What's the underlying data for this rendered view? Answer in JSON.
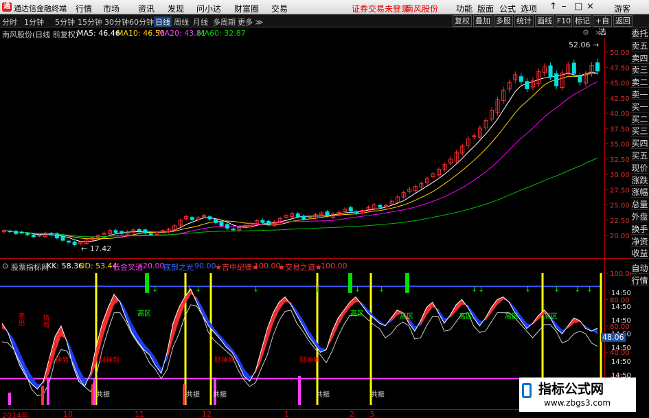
{
  "window": {
    "app_title": "通达信金融终端",
    "logo": "通",
    "menus": [
      "行情",
      "市场",
      "资讯",
      "发现",
      "问小达",
      "财富圈",
      "交易"
    ],
    "status": "证券交易未登录",
    "stock": "南风股份",
    "right_menus": [
      "功能",
      "版面",
      "公式",
      "选项"
    ],
    "user": "游客"
  },
  "periods": [
    "分时",
    "1分钟",
    "5分钟",
    "15分钟",
    "30分钟",
    "60分钟",
    "日线",
    "周线",
    "月线",
    "多周期",
    "更多"
  ],
  "period_selected": "日线",
  "toolbar_right": [
    "复权",
    "叠加",
    "多股",
    "统计",
    "画线",
    "F10",
    "标记",
    "+自选",
    "返回"
  ],
  "price_header": {
    "title": "南风股份(日线 前复权)",
    "ma5": "MA5: 46.46",
    "ma10": "MA10: 46.50",
    "ma20": "MA20: 43.81",
    "ma60": "MA60: 32.87"
  },
  "price_axis": [
    "50.00",
    "47.50",
    "45.00",
    "42.50",
    "40.00",
    "37.50",
    "35.00",
    "32.50",
    "30.00",
    "27.50",
    "25.00",
    "22.50",
    "20.00"
  ],
  "price_annotations": {
    "high": "52.06",
    "low": "17.42"
  },
  "side_tabs": [
    "委托",
    "卖五",
    "卖四",
    "卖三",
    "卖二",
    "卖一",
    "买一",
    "买二",
    "买三",
    "买四",
    "买五",
    "现价",
    "涨跌",
    "涨幅",
    "总量",
    "外盘",
    "换手",
    "净资",
    "收益"
  ],
  "side_tabs_lower": [
    "自动",
    "行情"
  ],
  "indicator_header": {
    "name": "股票指标网",
    "kk": "KK: 58.36",
    "dd": "DD: 53.44",
    "t1": "低金叉通",
    "v1": "20.00",
    "t2": "底部之光",
    "v2": "90.00",
    "t3": "★吉中纪律★",
    "v3": "100.00",
    "t4": "★交易之道★",
    "v4": "100.00"
  },
  "indicator_axis": [
    "100.00",
    "80.00",
    "60.00",
    "40.00",
    "20.00",
    "14:50",
    "14:50",
    "14:50",
    "14:50",
    "14:50",
    "14:50",
    "14:50",
    "14:50"
  ],
  "indicator_value": "48.06",
  "indicator_labels": {
    "buy": "卖出",
    "hold": "持有",
    "zone_high": "高区",
    "bottom": "财神到",
    "resonate": "共振"
  },
  "time_axis": [
    "2014年",
    "10",
    "11",
    "12",
    "1",
    "2",
    "3"
  ],
  "watermark": {
    "title": "指标公式网",
    "url": "www.zbgs3.com"
  },
  "colors": {
    "up": "#ff3232",
    "down": "#00e0e0",
    "ma5": "#ffffff",
    "ma10": "#ffd700",
    "ma20": "#ff00ff",
    "ma60": "#00c000",
    "accent": "#e00000"
  },
  "chart_data": [
    {
      "type": "candlestick",
      "title": "南风股份(日线 前复权)",
      "ylim": [
        17.42,
        52.06
      ],
      "series": [
        {
          "name": "MA5",
          "last": 46.46
        },
        {
          "name": "MA10",
          "last": 46.5
        },
        {
          "name": "MA20",
          "last": 43.81
        },
        {
          "name": "MA60",
          "last": 32.87
        }
      ],
      "closes": [
        20.8,
        20.6,
        20.3,
        20.5,
        20.1,
        19.8,
        20.0,
        20.4,
        20.2,
        19.6,
        19.2,
        18.9,
        18.5,
        18.9,
        19.3,
        19.6,
        20.0,
        20.4,
        20.8,
        20.5,
        20.3,
        20.6,
        20.9,
        20.7,
        20.4,
        20.2,
        20.5,
        20.8,
        21.0,
        21.6,
        22.5,
        23.1,
        22.6,
        22.9,
        23.3,
        22.7,
        22.1,
        21.6,
        21.2,
        20.9,
        21.3,
        21.6,
        22.0,
        22.4,
        22.1,
        21.8,
        22.2,
        22.8,
        23.3,
        23.6,
        23.1,
        22.7,
        23.0,
        23.4,
        23.7,
        23.2,
        23.5,
        23.8,
        24.3,
        24.0,
        23.7,
        24.1,
        24.6,
        25.0,
        24.6,
        24.9,
        25.6,
        26.3,
        27.0,
        27.6,
        28.0,
        28.5,
        29.3,
        30.1,
        30.8,
        31.6,
        32.5,
        33.6,
        34.6,
        35.8,
        36.3,
        37.6,
        38.8,
        40.5,
        42.2,
        43.8,
        45.0,
        46.3,
        45.2,
        44.0,
        45.3,
        46.8,
        47.6,
        46.0,
        44.5,
        46.6,
        47.9,
        46.5,
        45.1,
        46.4,
        47.8,
        46.9
      ]
    },
    {
      "type": "line",
      "title": "股票指标网",
      "ylim": [
        0,
        100
      ],
      "series": [
        {
          "name": "KK",
          "last": 58.36
        },
        {
          "name": "DD",
          "last": 53.44
        }
      ],
      "references": [
        {
          "name": "低金叉通",
          "value": 20.0
        },
        {
          "name": "底部之光",
          "value": 90.0
        },
        {
          "name": "★吉中纪律★",
          "value": 100.0
        },
        {
          "name": "★交易之道★",
          "value": 100.0
        }
      ],
      "kk": [
        62,
        55,
        42,
        30,
        22,
        16,
        12,
        18,
        35,
        52,
        60,
        48,
        30,
        18,
        14,
        24,
        45,
        62,
        74,
        84,
        78,
        66,
        55,
        48,
        42,
        38,
        30,
        24,
        40,
        62,
        74,
        82,
        88,
        78,
        68,
        60,
        55,
        50,
        44,
        40,
        32,
        22,
        18,
        26,
        42,
        58,
        70,
        78,
        82,
        76,
        68,
        60,
        52,
        46,
        40,
        42,
        56,
        66,
        72,
        78,
        82,
        76,
        70,
        66,
        62,
        60,
        66,
        72,
        70,
        62,
        56,
        64,
        74,
        78,
        70,
        62,
        68,
        76,
        80,
        74,
        66,
        60,
        66,
        74,
        80,
        82,
        78,
        70,
        64,
        58,
        62,
        68,
        72,
        66,
        58,
        54,
        60,
        66,
        64,
        58,
        56,
        58.36
      ],
      "dd": [
        58,
        56,
        50,
        40,
        30,
        22,
        16,
        16,
        24,
        40,
        52,
        50,
        40,
        28,
        20,
        20,
        32,
        50,
        64,
        76,
        80,
        72,
        62,
        54,
        47,
        42,
        36,
        28,
        34,
        50,
        64,
        76,
        84,
        82,
        74,
        65,
        58,
        53,
        48,
        43,
        37,
        28,
        22,
        24,
        34,
        48,
        62,
        72,
        78,
        78,
        72,
        65,
        57,
        50,
        44,
        42,
        50,
        60,
        68,
        74,
        78,
        78,
        73,
        68,
        64,
        61,
        63,
        68,
        70,
        66,
        60,
        60,
        68,
        74,
        73,
        66,
        66,
        71,
        76,
        76,
        70,
        64,
        64,
        70,
        76,
        80,
        79,
        74,
        68,
        62,
        61,
        65,
        69,
        68,
        62,
        57,
        58,
        62,
        63,
        60,
        57,
        53.44
      ]
    }
  ]
}
